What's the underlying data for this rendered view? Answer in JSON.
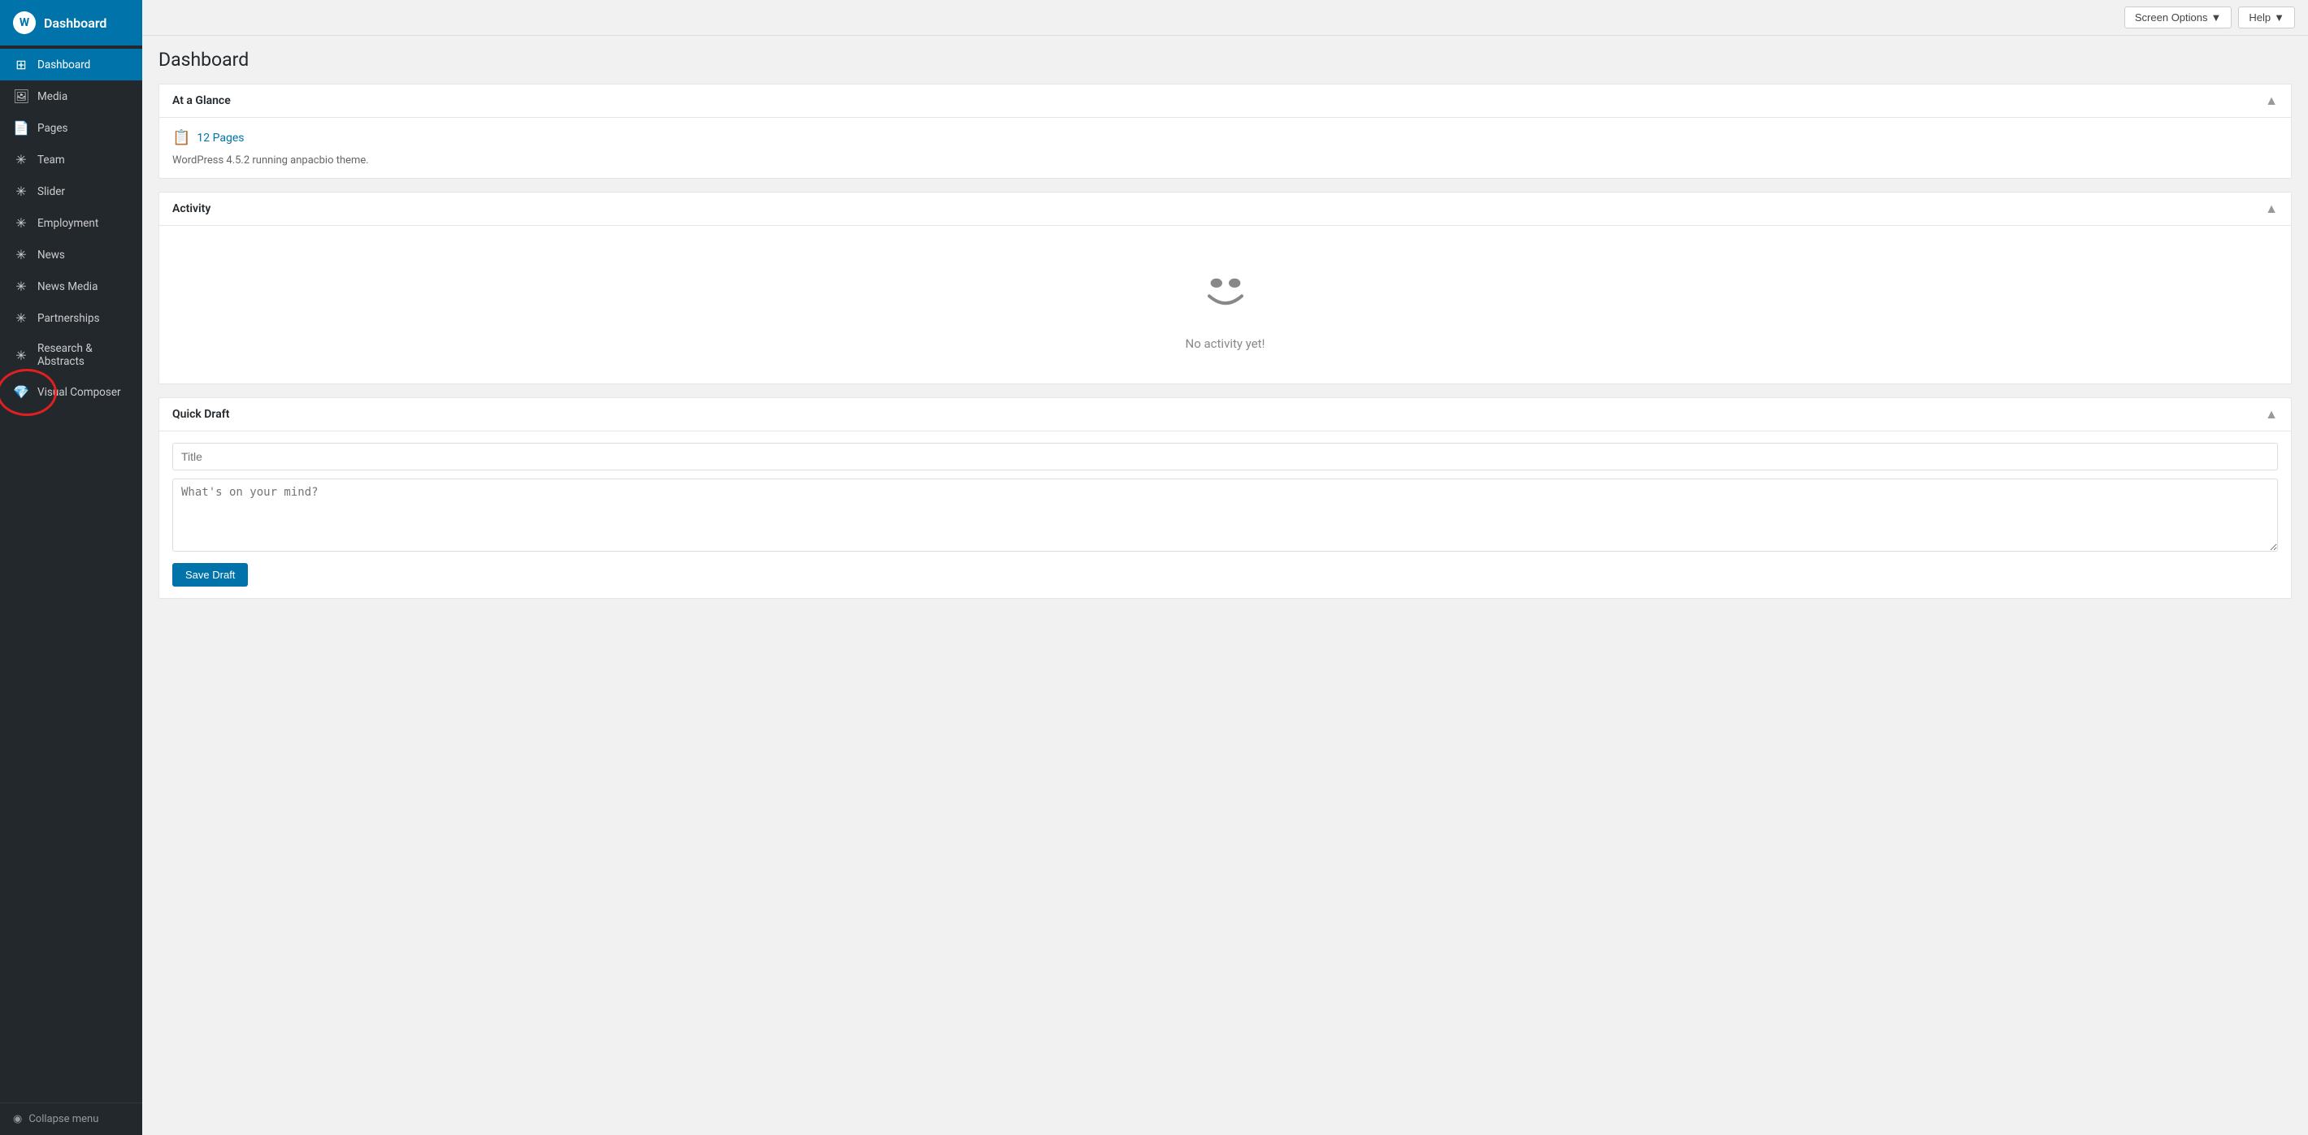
{
  "sidebar": {
    "logo_text": "Dashboard",
    "items": [
      {
        "id": "dashboard",
        "label": "Dashboard",
        "icon": "⊞",
        "active": true
      },
      {
        "id": "media",
        "label": "Media",
        "icon": "🖼"
      },
      {
        "id": "pages",
        "label": "Pages",
        "icon": "📄"
      },
      {
        "id": "team",
        "label": "Team",
        "icon": "✳"
      },
      {
        "id": "slider",
        "label": "Slider",
        "icon": "✳"
      },
      {
        "id": "employment",
        "label": "Employment",
        "icon": "✳"
      },
      {
        "id": "news",
        "label": "News",
        "icon": "✳"
      },
      {
        "id": "news-media",
        "label": "News Media",
        "icon": "✳"
      },
      {
        "id": "partnerships",
        "label": "Partnerships",
        "icon": "✳"
      },
      {
        "id": "research-abstracts",
        "label": "Research & Abstracts",
        "icon": "✳"
      },
      {
        "id": "visual-composer",
        "label": "Visual Composer",
        "icon": "💎"
      }
    ],
    "collapse_label": "Collapse menu"
  },
  "topbar": {
    "screen_options_label": "Screen Options",
    "help_label": "Help"
  },
  "page_title": "Dashboard",
  "widgets": {
    "at_a_glance": {
      "title": "At a Glance",
      "pages_count": "12 Pages",
      "wp_version": "WordPress 4.5.2 running anpacbio theme."
    },
    "activity": {
      "title": "Activity",
      "empty_text": "No activity yet!"
    },
    "quick_draft": {
      "title": "Quick Draft",
      "title_placeholder": "Title",
      "content_placeholder": "What's on your mind?",
      "save_button_label": "Save Draft"
    }
  }
}
